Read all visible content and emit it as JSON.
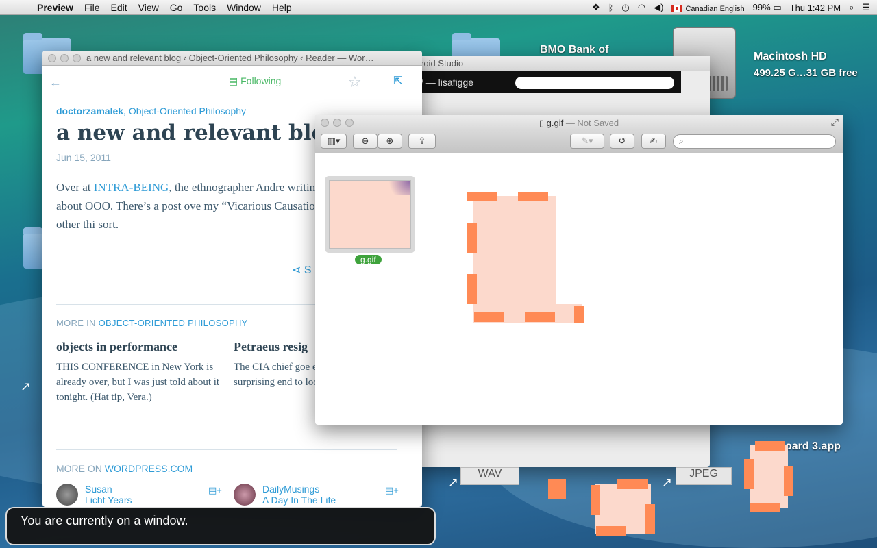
{
  "menubar": {
    "app": "Preview",
    "items": [
      "File",
      "Edit",
      "View",
      "Go",
      "Tools",
      "Window",
      "Help"
    ],
    "input_source": "Canadian English",
    "battery": "99%",
    "clock": "Thu 1:42 PM"
  },
  "desktop": {
    "bmo_label": "BMO Bank of",
    "hdd_name": "Macintosh HD",
    "hdd_info": "499.25 G…31 GB free",
    "wav_label": "WAV",
    "jpeg_label": "JPEG",
    "app_label": "oard 3.app"
  },
  "reader": {
    "window_title": "a new and relevant blog ‹ Object-Oriented Philosophy ‹ Reader — Wor…",
    "following": "Following",
    "author": "doctorzamalek",
    "blog": "Object-Oriented Philosophy",
    "title": "a new and relevant blog",
    "date": "Jun 15, 2011",
    "body_pre": "Over at ",
    "body_link": "INTRA-BEING",
    "body_post": ", the ethnographer Andre writing quite a bit about OOO. There’s a post ove my “Vicarious Causation” article, and other thi sort.",
    "share": "S",
    "more_in_prefix": "MORE IN ",
    "more_in_link": "OBJECT-ORIENTED PHILOSOPHY",
    "cards": [
      {
        "title": "objects in performance",
        "text": "THIS CONFERENCE in New York is already over, but I was just told about it tonight. (Hat tip, Vera.)"
      },
      {
        "title": "Petraeus resig",
        "text": "The CIA chief goe extramarital affa surprising end to looked like an un"
      }
    ],
    "more_on_prefix": "MORE ON ",
    "more_on_link": "WORDPRESS.COM",
    "sites": [
      {
        "name": "Susan",
        "blog": "Licht Years"
      },
      {
        "name": "DailyMusings",
        "blog": "A Day In The Life"
      }
    ]
  },
  "android": {
    "title": "roid Studio",
    "bar_text": "/ — lisafigge"
  },
  "preview": {
    "filename": "g.gif",
    "status": " — Not Saved",
    "thumb_label": "g.gif"
  },
  "voiceover": "You are currently on a window."
}
